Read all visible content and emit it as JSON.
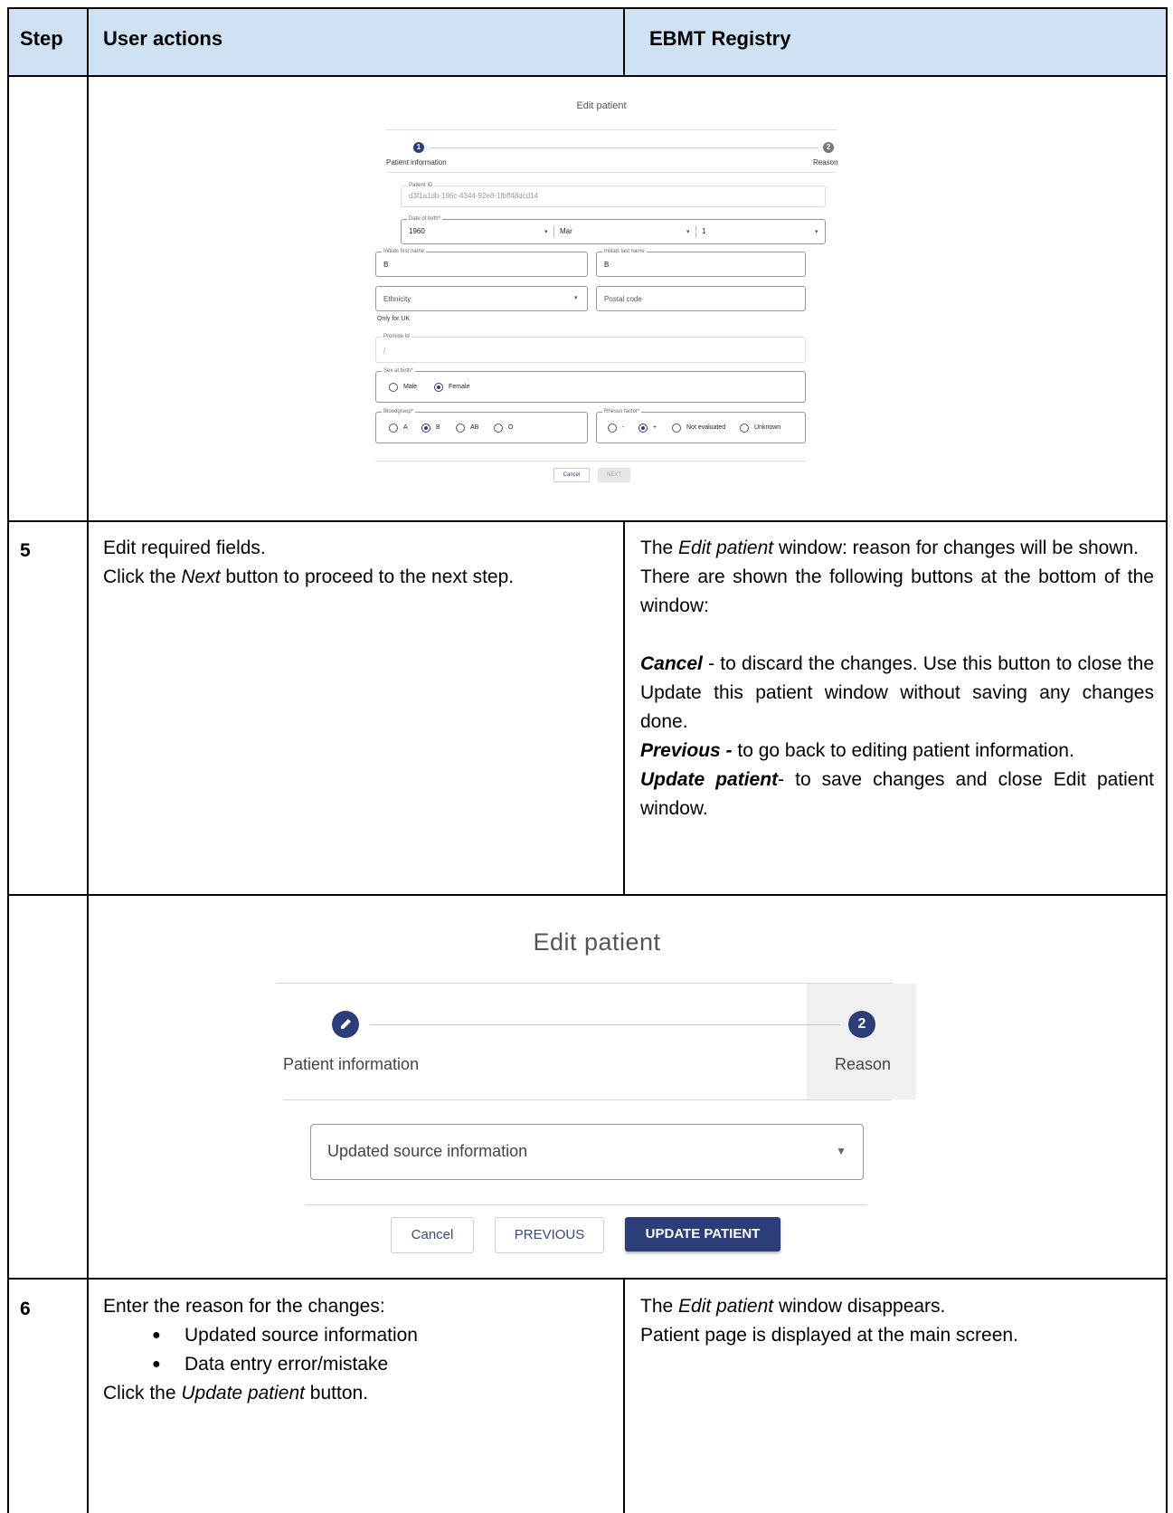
{
  "table": {
    "headers": {
      "step": "Step",
      "user_actions": "User actions",
      "registry": "EBMT Registry"
    }
  },
  "row5": {
    "step": "5",
    "actions": [
      "Edit required fields.",
      "Click the ",
      "Next",
      " button to proceed to the next step."
    ],
    "registry": {
      "p1_a": "The ",
      "p1_em": "Edit patient",
      "p1_b": " window: reason for changes will be shown.",
      "p2": "There are shown the following buttons at the bottom of the window:",
      "cancel_term": "Cancel",
      "cancel_desc": " - to discard the changes. Use this button to close the Update this patient window without saving any changes done.",
      "previous_term": "Previous -",
      "previous_desc": " to go back to editing patient information.",
      "update_term": "Update patient",
      "update_desc": "- to save changes and close Edit patient window."
    }
  },
  "row6": {
    "step": "6",
    "intro": "Enter the reason for the changes:",
    "bullets": [
      "Updated source information",
      "Data entry error/mistake"
    ],
    "click_a": "Click the ",
    "click_em": "Update patient",
    "click_b": " button.",
    "registry_a": "The ",
    "registry_em": "Edit patient",
    "registry_b": " window disappears.",
    "registry_2": "Patient page is displayed at the main screen."
  },
  "small_dialog": {
    "title": "Edit patient",
    "step1_num": "1",
    "step2_num": "2",
    "step1_label": "Patient information",
    "step2_label": "Reason",
    "patient_id_label": "Patient ID",
    "patient_id": "d3f1a1db-196c-4344-92e8-1fbff48dcd14",
    "dob_label": "Date of birth*",
    "dob_year": "1960",
    "dob_month": "Mar",
    "dob_day": "1",
    "initials_first_label": "Initials first name",
    "initials_first": "B",
    "initials_last_label": "Initials last name",
    "initials_last": "B",
    "ethnicity": "Ethnicity",
    "postal_code": "Postal code",
    "only_uk": "Only for UK",
    "promise_label": "Promise Id",
    "promise_value": "/",
    "sex_label": "Sex at birth*",
    "sex_options": [
      "Male",
      "Female"
    ],
    "blood_label": "Bloodgroup*",
    "blood_options": [
      "A",
      "B",
      "AB",
      "O"
    ],
    "rhesus_label": "Rhesus factor*",
    "rhesus_options": [
      "-",
      "+",
      "Not evaluated",
      "Unknown"
    ],
    "cancel": "Cancel",
    "next": "NEXT"
  },
  "large_dialog": {
    "title": "Edit patient",
    "step2_num": "2",
    "step1_label": "Patient information",
    "step2_label": "Reason",
    "reason_value": "Updated source information",
    "cancel": "Cancel",
    "previous": "PREVIOUS",
    "update": "UPDATE PATIENT"
  },
  "colors": {
    "header_bg": "#cfe2f3",
    "primary": "#2c3e7a"
  }
}
